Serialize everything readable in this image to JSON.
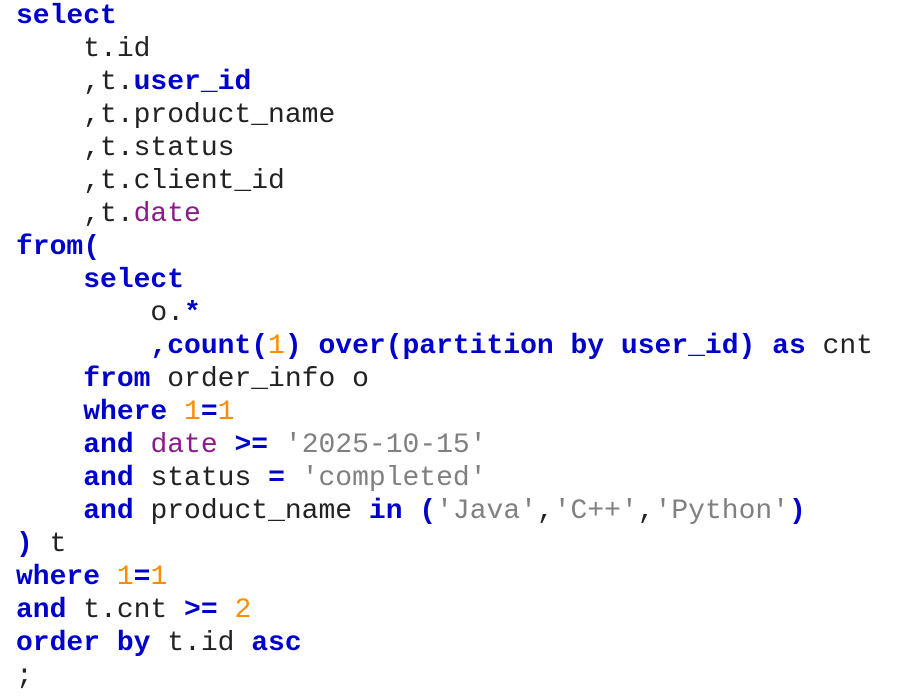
{
  "colors": {
    "keyword": "#0000cc",
    "identifier": "#222222",
    "number": "#ff8c00",
    "string": "#808080",
    "builtin": "#8b1a8b",
    "background": "#ffffff"
  },
  "code_lines": [
    [
      {
        "t": "select",
        "k": "kw"
      }
    ],
    [
      {
        "t": "    t.id",
        "k": "id"
      }
    ],
    [
      {
        "t": "    ,t.",
        "k": "id"
      },
      {
        "t": "user_id",
        "k": "col"
      }
    ],
    [
      {
        "t": "    ,t.product_name",
        "k": "id"
      }
    ],
    [
      {
        "t": "    ,t.status",
        "k": "id"
      }
    ],
    [
      {
        "t": "    ,t.client_id",
        "k": "id"
      }
    ],
    [
      {
        "t": "    ,t.",
        "k": "id"
      },
      {
        "t": "date",
        "k": "var"
      }
    ],
    [
      {
        "t": "from",
        "k": "kw"
      },
      {
        "t": "(",
        "k": "op"
      }
    ],
    [
      {
        "t": "    ",
        "k": "id"
      },
      {
        "t": "select",
        "k": "kw"
      }
    ],
    [
      {
        "t": "        o.",
        "k": "id"
      },
      {
        "t": "*",
        "k": "op"
      }
    ],
    [
      {
        "t": "        ",
        "k": "id"
      },
      {
        "t": ",count(",
        "k": "fn"
      },
      {
        "t": "1",
        "k": "num"
      },
      {
        "t": ") over(partition by user_id) as",
        "k": "kw"
      },
      {
        "t": " cnt",
        "k": "id"
      }
    ],
    [
      {
        "t": "    ",
        "k": "id"
      },
      {
        "t": "from",
        "k": "kw"
      },
      {
        "t": " order_info o",
        "k": "id"
      }
    ],
    [
      {
        "t": "    ",
        "k": "id"
      },
      {
        "t": "where",
        "k": "kw"
      },
      {
        "t": " ",
        "k": "id"
      },
      {
        "t": "1",
        "k": "num"
      },
      {
        "t": "=",
        "k": "op"
      },
      {
        "t": "1",
        "k": "num"
      }
    ],
    [
      {
        "t": "    ",
        "k": "id"
      },
      {
        "t": "and",
        "k": "kw"
      },
      {
        "t": " ",
        "k": "id"
      },
      {
        "t": "date",
        "k": "var"
      },
      {
        "t": " ",
        "k": "id"
      },
      {
        "t": ">=",
        "k": "op"
      },
      {
        "t": " ",
        "k": "id"
      },
      {
        "t": "'2025-10-15'",
        "k": "str"
      }
    ],
    [
      {
        "t": "    ",
        "k": "id"
      },
      {
        "t": "and",
        "k": "kw"
      },
      {
        "t": " status ",
        "k": "id"
      },
      {
        "t": "=",
        "k": "op"
      },
      {
        "t": " ",
        "k": "id"
      },
      {
        "t": "'completed'",
        "k": "str"
      }
    ],
    [
      {
        "t": "    ",
        "k": "id"
      },
      {
        "t": "and",
        "k": "kw"
      },
      {
        "t": " product_name ",
        "k": "id"
      },
      {
        "t": "in",
        "k": "kw"
      },
      {
        "t": " (",
        "k": "op"
      },
      {
        "t": "'Java'",
        "k": "str"
      },
      {
        "t": ",",
        "k": "id"
      },
      {
        "t": "'C++'",
        "k": "str"
      },
      {
        "t": ",",
        "k": "id"
      },
      {
        "t": "'Python'",
        "k": "str"
      },
      {
        "t": ")",
        "k": "op"
      }
    ],
    [
      {
        "t": ")",
        "k": "op"
      },
      {
        "t": " t",
        "k": "id"
      }
    ],
    [
      {
        "t": "where",
        "k": "kw"
      },
      {
        "t": " ",
        "k": "id"
      },
      {
        "t": "1",
        "k": "num"
      },
      {
        "t": "=",
        "k": "op"
      },
      {
        "t": "1",
        "k": "num"
      }
    ],
    [
      {
        "t": "and",
        "k": "kw"
      },
      {
        "t": " t.cnt ",
        "k": "id"
      },
      {
        "t": ">=",
        "k": "op"
      },
      {
        "t": " ",
        "k": "id"
      },
      {
        "t": "2",
        "k": "num"
      }
    ],
    [
      {
        "t": "order by",
        "k": "kw"
      },
      {
        "t": " t.id ",
        "k": "id"
      },
      {
        "t": "asc",
        "k": "kw"
      }
    ],
    [
      {
        "t": ";",
        "k": "id"
      }
    ]
  ]
}
